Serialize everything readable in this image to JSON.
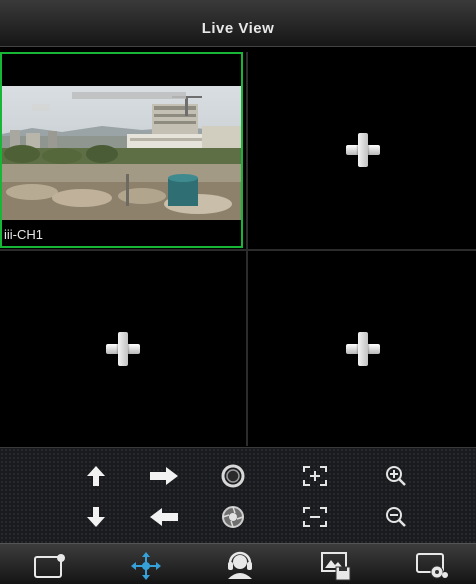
{
  "header": {
    "title": "Live View"
  },
  "panes": [
    {
      "id": 1,
      "state": "video",
      "label": "iii-CH1",
      "selected": true
    },
    {
      "id": 2,
      "state": "empty",
      "icon": "plus-icon"
    },
    {
      "id": 3,
      "state": "empty",
      "icon": "plus-icon"
    },
    {
      "id": 4,
      "state": "empty",
      "icon": "plus-icon"
    }
  ],
  "ptz_controls": {
    "row1": [
      "arrow-up-icon",
      "arrow-right-icon",
      "iris-open-icon",
      "focus-near-icon",
      "zoom-in-icon"
    ],
    "row2": [
      "arrow-down-icon",
      "arrow-left-icon",
      "iris-close-icon",
      "focus-far-icon",
      "zoom-out-icon"
    ]
  },
  "tabbar": [
    "screen-layout-icon",
    "ptz-move-icon",
    "audio-headset-icon",
    "snapshot-save-icon",
    "settings-record-icon"
  ],
  "colors": {
    "selected_border": "#18b636",
    "background": "#000000",
    "text": "#e8e8e8"
  }
}
